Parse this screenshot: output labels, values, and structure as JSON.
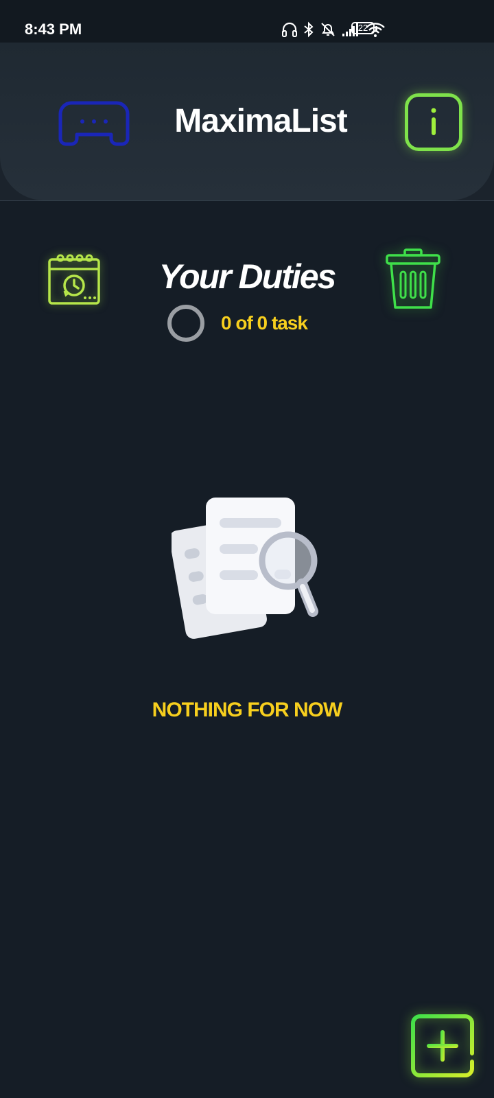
{
  "status_bar": {
    "time": "8:43 PM",
    "battery_level": "22",
    "icons": [
      "headphones-icon",
      "bluetooth-icon",
      "notifications-off-icon",
      "cellular-signal-icon",
      "wifi-icon",
      "battery-icon"
    ]
  },
  "header": {
    "title": "MaximaList",
    "left_icon": "gamepad-icon",
    "right_icon": "info-icon"
  },
  "duties": {
    "title": "Your Duties",
    "progress_text": "0 of 0 task",
    "progress_fraction": 0,
    "left_icon": "calendar-clock-icon",
    "right_icon": "trash-icon"
  },
  "empty_state": {
    "icon": "document-search-icon",
    "message": "NOTHING FOR NOW"
  },
  "fab": {
    "icon": "plus-icon"
  },
  "colors": {
    "background": "#151d26",
    "header": "#222c35",
    "accent_yellow": "#f7cf1e",
    "accent_green": "#7fe24b",
    "gamepad_blue": "#1a26b8",
    "ring_gray": "#9a9ea3"
  }
}
